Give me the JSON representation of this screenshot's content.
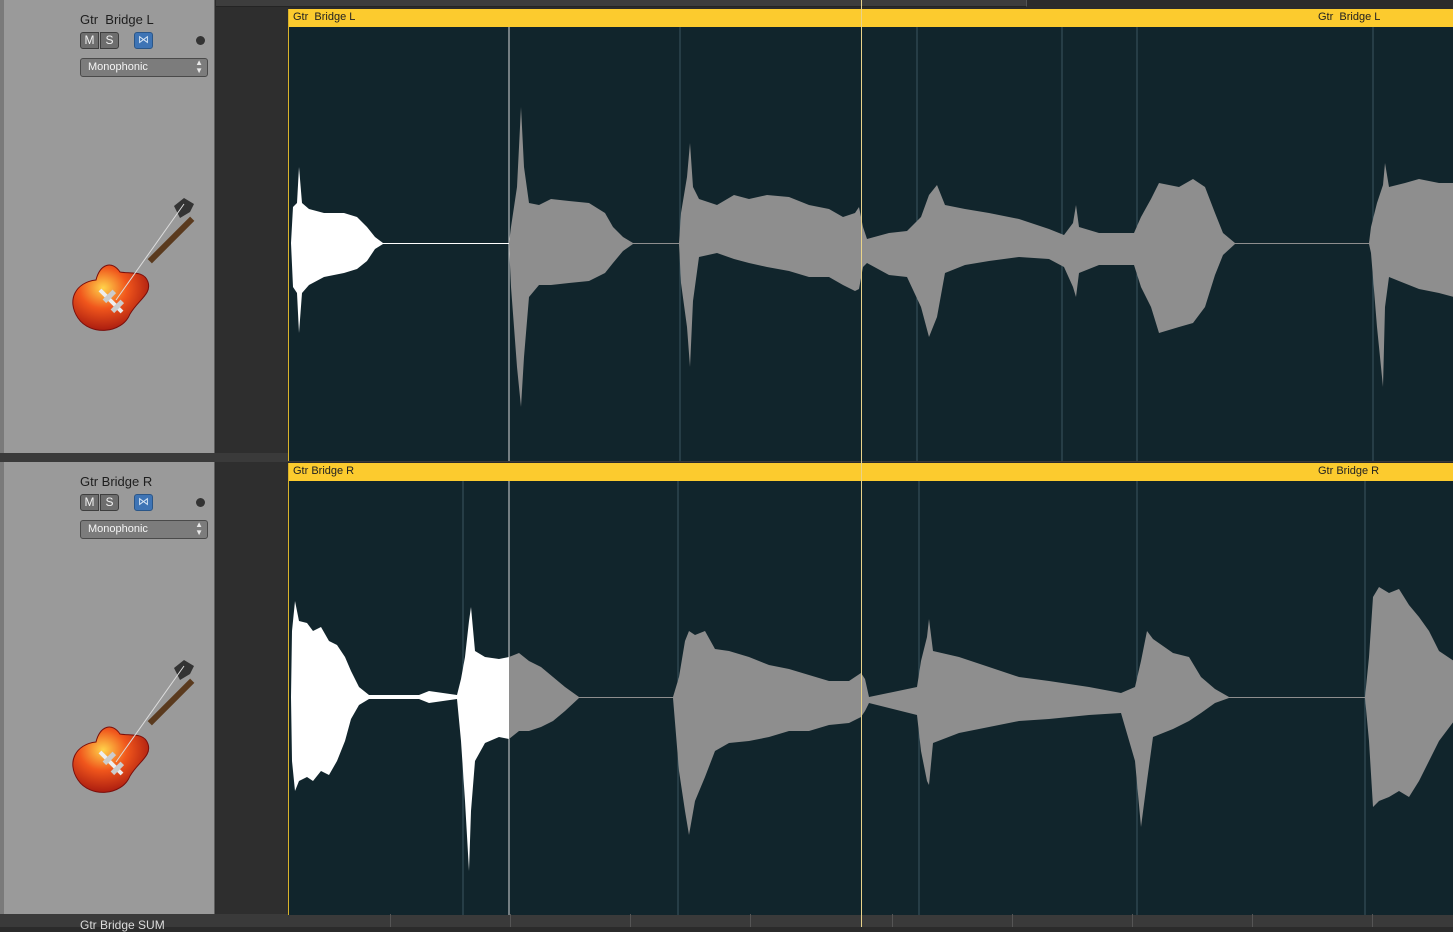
{
  "tracks": [
    {
      "name": "Gtr  Bridge L",
      "mute_label": "M",
      "solo_label": "S",
      "flex_label": "⋈",
      "flex_mode": "Monophonic",
      "icon": "electric-guitar-icon",
      "region_title_left": "Gtr  Bridge L",
      "region_title_right": "Gtr  Bridge L"
    },
    {
      "name": "Gtr Bridge R",
      "mute_label": "M",
      "solo_label": "S",
      "flex_label": "⋈",
      "flex_mode": "Monophonic",
      "icon": "electric-guitar-icon",
      "region_title_left": "Gtr Bridge R",
      "region_title_right": "Gtr Bridge R"
    }
  ],
  "next_track_partial_name": "Gtr Bridge SUM",
  "colors": {
    "region_header": "#fccb2e",
    "region_background": "#11252c",
    "waveform_selected": "#ffffff",
    "waveform_unselected": "#8e8e8e",
    "track_header": "#9a9a9a",
    "flex_button": "#3e74b5"
  }
}
